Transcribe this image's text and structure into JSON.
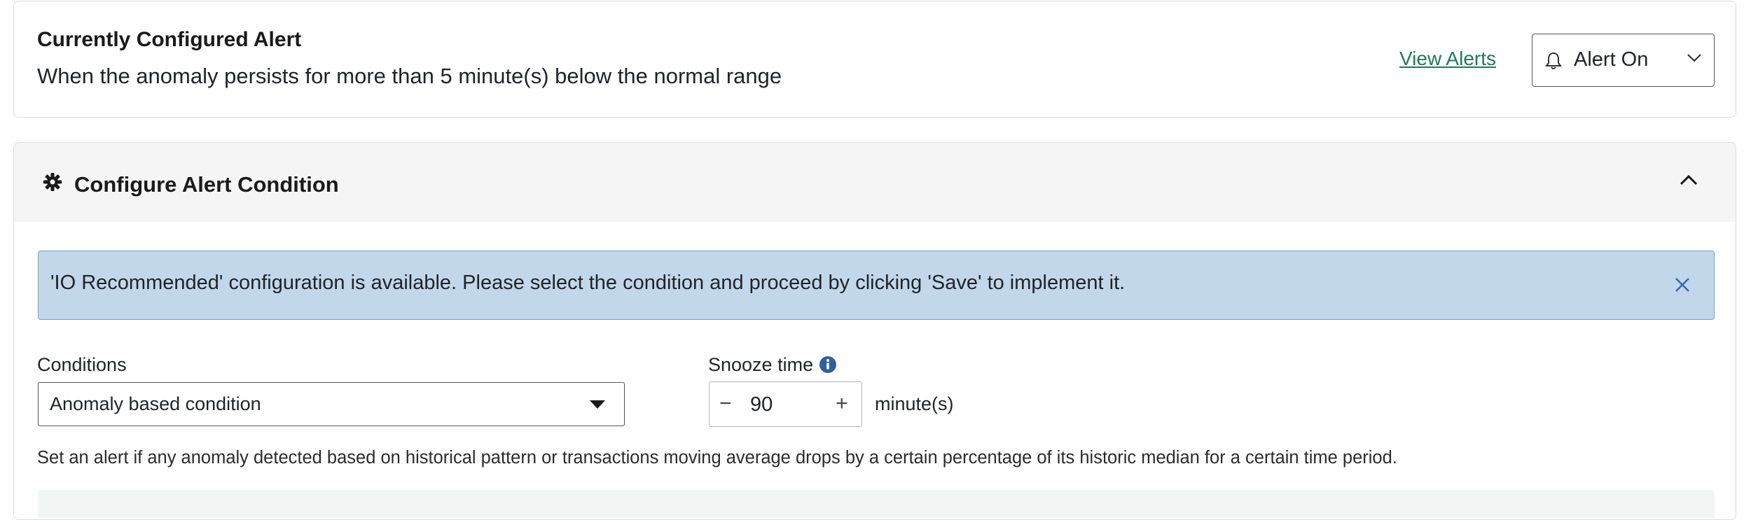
{
  "current_alert": {
    "title": "Currently Configured Alert",
    "description": "When the anomaly persists for more than 5 minute(s) below the normal range",
    "view_alerts_link": "View Alerts",
    "alert_status_select": "Alert On",
    "bell_icon": "bell-icon",
    "chevron_icon": "chevron-down-icon"
  },
  "configure_section": {
    "title": "Configure Alert Condition",
    "gear_icon": "gear-icon",
    "collapse_icon": "chevron-up-icon",
    "banner": {
      "text": "'IO Recommended' configuration is available. Please select the condition and proceed by clicking 'Save' to implement it.",
      "close_icon": "close-icon",
      "bg_color": "#c2d7ea"
    },
    "conditions": {
      "label": "Conditions",
      "selected": "Anomaly based condition"
    },
    "snooze": {
      "label": "Snooze time",
      "info_icon": "info-icon",
      "value": "90",
      "minus": "−",
      "plus": "+",
      "unit": "minute(s)"
    },
    "helper_text": "Set an alert if any anomaly detected based on historical pattern or transactions moving average drops by a certain percentage of its historic median for a certain time period."
  },
  "colors": {
    "link": "#1d7a57",
    "banner_border": "#6fa0cf",
    "header_bg": "#f5f5f5"
  }
}
